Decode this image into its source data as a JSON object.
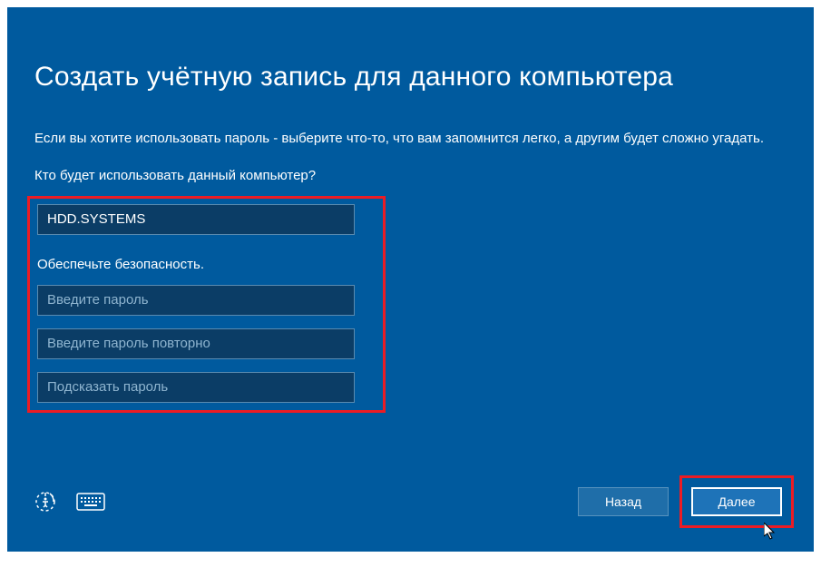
{
  "title": "Создать учётную запись для данного компьютера",
  "subtitle": "Если вы хотите использовать пароль - выберите что-то, что вам запомнится легко, а другим будет сложно угадать.",
  "sections": {
    "user_label": "Кто будет использовать данный компьютер?",
    "security_label": "Обеспечьте безопасность."
  },
  "fields": {
    "username_value": "HDD.SYSTEMS",
    "password_placeholder": "Введите пароль",
    "password_confirm_placeholder": "Введите пароль повторно",
    "password_hint_placeholder": "Подсказать пароль"
  },
  "buttons": {
    "back": "Назад",
    "next": "Далее"
  }
}
